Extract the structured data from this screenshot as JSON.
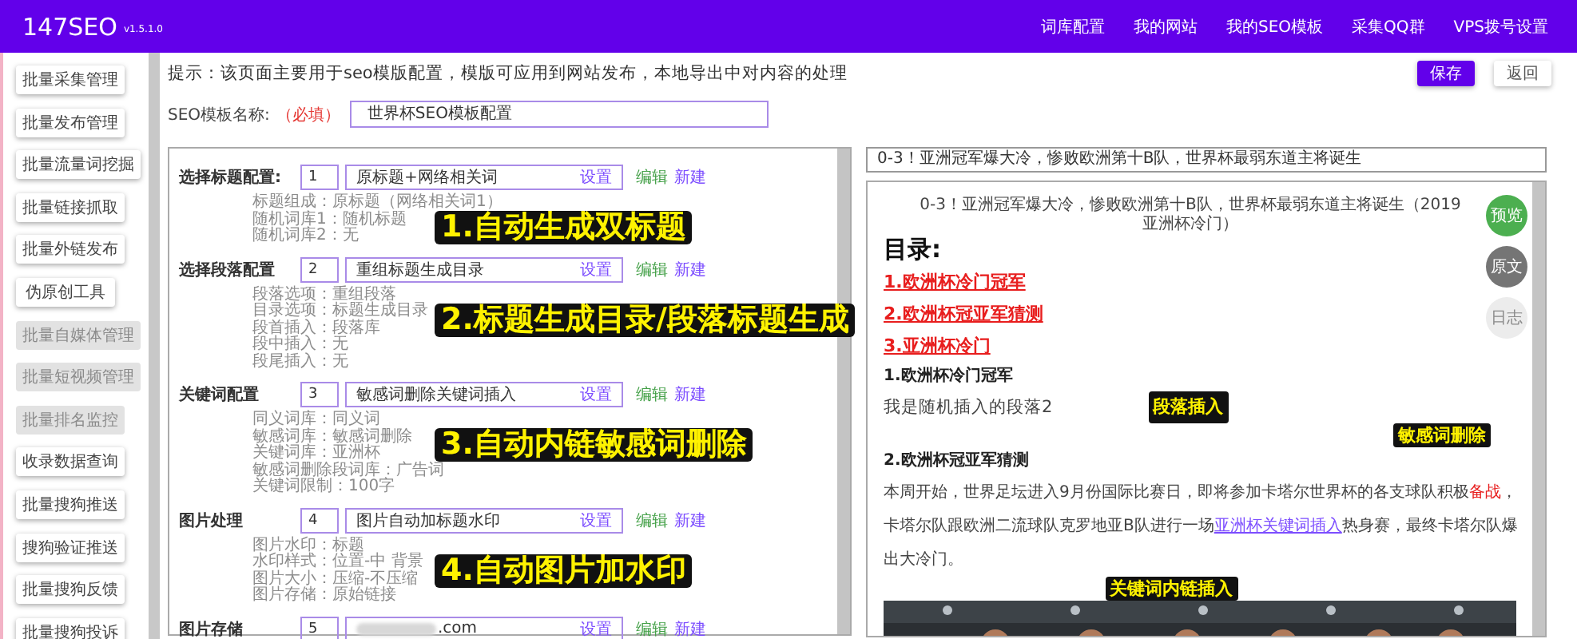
{
  "header": {
    "logo": "147SEO",
    "version": "v1.5.1.0",
    "nav": [
      "词库配置",
      "我的网站",
      "我的SEO模板",
      "采集QQ群",
      "VPS拨号设置"
    ]
  },
  "sidebar": {
    "items": [
      {
        "label": "批量采集管理",
        "disabled": false
      },
      {
        "label": "批量发布管理",
        "disabled": false
      },
      {
        "label": "批量流量词挖掘",
        "disabled": false
      },
      {
        "label": "批量链接抓取",
        "disabled": false
      },
      {
        "label": "批量外链发布",
        "disabled": false
      },
      {
        "label": "伪原创工具",
        "disabled": false
      },
      {
        "label": "批量自媒体管理",
        "disabled": true
      },
      {
        "label": "批量短视频管理",
        "disabled": true
      },
      {
        "label": "批量排名监控",
        "disabled": true
      },
      {
        "label": "收录数据查询",
        "disabled": false
      },
      {
        "label": "批量搜狗推送",
        "disabled": false
      },
      {
        "label": "搜狗验证推送",
        "disabled": false
      },
      {
        "label": "批量搜狗反馈",
        "disabled": false
      },
      {
        "label": "批量搜狗投诉",
        "disabled": false
      }
    ]
  },
  "hint": "提示：该页面主要用于seo模版配置，模版可应用到网站发布，本地导出中对内容的处理",
  "actions": [
    {
      "label": "保存",
      "primary": true
    },
    {
      "label": "返回",
      "primary": false
    }
  ],
  "template_name": {
    "label": "SEO模板名称:",
    "required": "（必填）",
    "value": "世界杯SEO模板配置"
  },
  "config_groups": [
    {
      "label": "选择标题配置:",
      "number": "1",
      "value": "原标题+网络相关词",
      "set": "设置",
      "edit": "编辑",
      "new": "新建",
      "details": [
        "标题组成：原标题（网络相关词1）",
        "随机词库1：随机标题",
        "随机词库2：无"
      ],
      "callout": "1.自动生成双标题"
    },
    {
      "label": "选择段落配置",
      "number": "2",
      "value": "重组标题生成目录",
      "set": "设置",
      "edit": "编辑",
      "new": "新建",
      "details": [
        "段落选项：重组段落",
        "目录选项：标题生成目录",
        "段首插入：段落库",
        "段中插入：无",
        "段尾插入：无"
      ],
      "callout": "2.标题生成目录/段落标题生成"
    },
    {
      "label": "关键词配置",
      "number": "3",
      "value": "敏感词删除关键词插入",
      "set": "设置",
      "edit": "编辑",
      "new": "新建",
      "details": [
        "同义词库：同义词",
        "敏感词库：敏感词删除",
        "关键词库：亚洲杯",
        "敏感词删除段词库：广告词",
        "关键词限制：100字"
      ],
      "callout": "3.自动内链敏感词删除"
    },
    {
      "label": "图片处理",
      "number": "4",
      "value": "图片自动加标题水印",
      "set": "设置",
      "edit": "编辑",
      "new": "新建",
      "details": [
        "图片水印：标题",
        "水印样式：位置-中 背景",
        "图片大小：压缩-不压缩",
        "图片存储：原始链接"
      ],
      "callout": "4.自动图片加水印"
    },
    {
      "label": "图片存储",
      "number": "5",
      "value": ".com",
      "redacted": true,
      "set": "设置",
      "edit": "编辑",
      "new": "新建"
    }
  ],
  "preview": {
    "title": "0-3！亚洲冠军爆大冷，惨败欧洲第十B队，世界杯最弱东道主将诞生",
    "side_buttons": [
      {
        "label": "预览",
        "kind": "preview"
      },
      {
        "label": "原文",
        "kind": "original"
      },
      {
        "label": "日志",
        "kind": "log"
      }
    ],
    "blocks": [
      {
        "kind": "title",
        "text": "0-3！亚洲冠军爆大冷，惨败欧洲第十B队，世界杯最弱东道主将诞生（2019亚洲杯冷门）"
      },
      {
        "kind": "toc_heading",
        "text": "目录:"
      },
      {
        "kind": "toc_link",
        "text": "1.欧洲杯冷门冠军"
      },
      {
        "kind": "toc_link",
        "text": "2.欧洲杯冠亚军猜测"
      },
      {
        "kind": "toc_link",
        "text": "3.亚洲杯冷门"
      },
      {
        "kind": "heading",
        "text": "1.欧洲杯冷门冠军"
      },
      {
        "kind": "text",
        "text": "我是随机插入的段落2",
        "callout": "段落插入"
      },
      {
        "kind": "tag",
        "text": "敏感词删除"
      },
      {
        "kind": "heading",
        "text": "2.欧洲杯冠亚军猜测"
      },
      {
        "kind": "paragraph",
        "segments": [
          {
            "kind": "text",
            "text": "本周开始，世界足坛进入9月份国际比赛日，即将参加卡塔尔世界杯的各支球队积极"
          },
          {
            "kind": "sensitive",
            "text": "备战"
          },
          {
            "kind": "text",
            "text": "，卡塔尔队跟欧洲二流球队克罗地亚B队进行一场"
          },
          {
            "kind": "link",
            "text": "亚洲杯关键词插入"
          },
          {
            "kind": "text",
            "text": "热身赛，最终卡塔尔队爆出大冷门。"
          }
        ]
      },
      {
        "kind": "banner",
        "text": "关键词内链插入"
      },
      {
        "kind": "picture"
      }
    ]
  }
}
